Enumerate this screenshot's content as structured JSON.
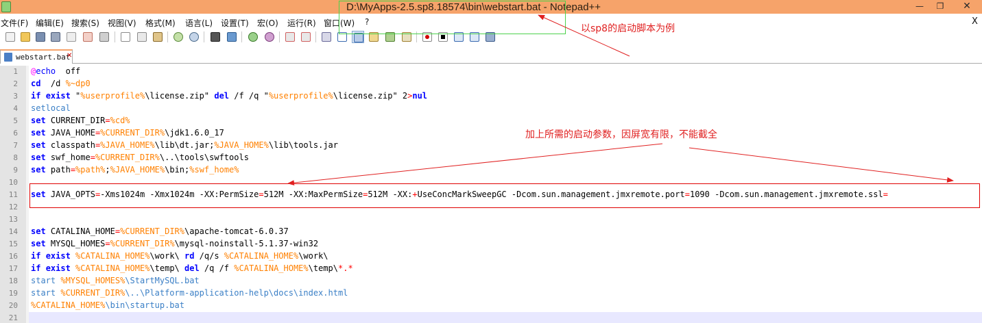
{
  "window": {
    "title": "D:\\MyApps-2.5.sp8.18574\\bin\\webstart.bat - Notepad++",
    "minimize_icon": "minimize-icon",
    "maximize_icon": "restore-icon",
    "close_icon": "close-icon",
    "minimize_glyph": "—",
    "maximize_glyph": "❐",
    "close_glyph": "✕",
    "title_bar_color": "#f6a36a"
  },
  "menu": {
    "items": [
      "文件(F)",
      "编辑(E)",
      "搜索(S)",
      "视图(V)",
      "格式(M)",
      "语言(L)",
      "设置(T)",
      "宏(O)",
      "运行(R)",
      "窗口(W)",
      "?"
    ],
    "close_glyph": "X"
  },
  "toolbar": {
    "icons": [
      "new-file-icon",
      "open-file-icon",
      "save-icon",
      "save-all-icon",
      "close-icon",
      "close-all-icon",
      "print-icon",
      "cut-icon",
      "copy-icon",
      "paste-icon",
      "undo-icon",
      "redo-icon",
      "find-icon",
      "replace-icon",
      "zoom-in-icon",
      "zoom-out-icon",
      "sync-vertical-icon",
      "sync-horizontal-icon",
      "word-wrap-icon",
      "show-all-chars-icon",
      "indent-guide-icon",
      "folder-workspace-icon",
      "doc-map-icon",
      "function-list-icon",
      "monitor-icon",
      "record-macro-icon",
      "stop-macro-icon",
      "play-macro-icon",
      "run-macro-multiple-icon",
      "save-macro-icon"
    ]
  },
  "tab": {
    "label": "webstart.bat",
    "close_glyph": "✕"
  },
  "editor": {
    "line_numbers": [
      "1",
      "2",
      "3",
      "4",
      "5",
      "6",
      "7",
      "8",
      "9",
      "10",
      "11",
      "12",
      "13",
      "14",
      "15",
      "16",
      "17",
      "18",
      "19",
      "20",
      "21"
    ],
    "lines": [
      [
        [
          "at",
          "@"
        ],
        [
          "kw2",
          "echo"
        ],
        [
          "",
          "  off"
        ]
      ],
      [
        [
          "kw",
          "cd"
        ],
        [
          "",
          "  /d "
        ],
        [
          "var",
          "%~dp0"
        ]
      ],
      [
        [
          "kw",
          "if"
        ],
        [
          "",
          " "
        ],
        [
          "kw",
          "exist"
        ],
        [
          "",
          " \""
        ],
        [
          "var",
          "%userprofile%"
        ],
        [
          "",
          "\\license.zip\" "
        ],
        [
          "kw",
          "del"
        ],
        [
          "",
          " /f /q \""
        ],
        [
          "var",
          "%userprofile%"
        ],
        [
          "",
          "\\license.zip\" 2"
        ],
        [
          "op",
          ">"
        ],
        [
          "kw",
          "nul"
        ]
      ],
      [
        [
          "cmd",
          "setlocal"
        ]
      ],
      [
        [
          "kw",
          "set"
        ],
        [
          "",
          " CURRENT_DIR"
        ],
        [
          "op",
          "="
        ],
        [
          "var",
          "%cd%"
        ]
      ],
      [
        [
          "kw",
          "set"
        ],
        [
          "",
          " JAVA_HOME"
        ],
        [
          "op",
          "="
        ],
        [
          "var",
          "%CURRENT_DIR%"
        ],
        [
          "",
          "\\jdk1.6.0_17"
        ]
      ],
      [
        [
          "kw",
          "set"
        ],
        [
          "",
          " classpath"
        ],
        [
          "op",
          "="
        ],
        [
          "var",
          "%JAVA_HOME%"
        ],
        [
          "",
          "\\lib\\dt.jar;"
        ],
        [
          "var",
          "%JAVA_HOME%"
        ],
        [
          "",
          "\\lib\\tools.jar"
        ]
      ],
      [
        [
          "kw",
          "set"
        ],
        [
          "",
          " swf_home"
        ],
        [
          "op",
          "="
        ],
        [
          "var",
          "%CURRENT_DIR%"
        ],
        [
          "",
          "\\..\\tools\\swftools"
        ]
      ],
      [
        [
          "kw",
          "set"
        ],
        [
          "",
          " path"
        ],
        [
          "op",
          "="
        ],
        [
          "var",
          "%path%"
        ],
        [
          "",
          ";"
        ],
        [
          "var",
          "%JAVA_HOME%"
        ],
        [
          "",
          "\\bin;"
        ],
        [
          "var",
          "%swf_home%"
        ]
      ],
      [],
      [
        [
          "kw",
          "set"
        ],
        [
          "",
          " JAVA_OPTS"
        ],
        [
          "op",
          "="
        ],
        [
          "",
          "-Xms1024m -Xmx1024m -XX:PermSize"
        ],
        [
          "op",
          "="
        ],
        [
          "",
          "512M -XX:MaxPermSize"
        ],
        [
          "op",
          "="
        ],
        [
          "",
          "512M -XX:"
        ],
        [
          "op",
          "+"
        ],
        [
          "",
          "UseConcMarkSweepGC -Dcom.sun.management.jmxremote.port"
        ],
        [
          "op",
          "="
        ],
        [
          "",
          "1090 -Dcom.sun.management.jmxremote.ssl"
        ],
        [
          "op",
          "="
        ]
      ],
      [],
      [],
      [
        [
          "kw",
          "set"
        ],
        [
          "",
          " CATALINA_HOME"
        ],
        [
          "op",
          "="
        ],
        [
          "var",
          "%CURRENT_DIR%"
        ],
        [
          "",
          "\\apache-tomcat-6.0.37"
        ]
      ],
      [
        [
          "kw",
          "set"
        ],
        [
          "",
          " MYSQL_HOMES"
        ],
        [
          "op",
          "="
        ],
        [
          "var",
          "%CURRENT_DIR%"
        ],
        [
          "",
          "\\mysql-noinstall-5.1.37-win32"
        ]
      ],
      [
        [
          "kw",
          "if"
        ],
        [
          "",
          " "
        ],
        [
          "kw",
          "exist"
        ],
        [
          "",
          " "
        ],
        [
          "var",
          "%CATALINA_HOME%"
        ],
        [
          "",
          "\\work\\ "
        ],
        [
          "kw",
          "rd"
        ],
        [
          "",
          " /q/s "
        ],
        [
          "var",
          "%CATALINA_HOME%"
        ],
        [
          "",
          "\\work\\"
        ]
      ],
      [
        [
          "kw",
          "if"
        ],
        [
          "",
          " "
        ],
        [
          "kw",
          "exist"
        ],
        [
          "",
          " "
        ],
        [
          "var",
          "%CATALINA_HOME%"
        ],
        [
          "",
          "\\temp\\ "
        ],
        [
          "kw",
          "del"
        ],
        [
          "",
          " /q /f "
        ],
        [
          "var",
          "%CATALINA_HOME%"
        ],
        [
          "",
          "\\temp\\"
        ],
        [
          "op",
          "*.*"
        ]
      ],
      [
        [
          "cmd",
          "start "
        ],
        [
          "var",
          "%MYSQL_HOMES%"
        ],
        [
          "cmd",
          "\\StartMySQL.bat"
        ]
      ],
      [
        [
          "cmd",
          "start "
        ],
        [
          "var",
          "%CURRENT_DIR%"
        ],
        [
          "cmd",
          "\\..\\Platform-application-help\\docs\\index.html"
        ]
      ],
      [
        [
          "var",
          "%CATALINA_HOME%"
        ],
        [
          "cmd",
          "\\bin\\startup.bat"
        ]
      ],
      []
    ]
  },
  "annotations": {
    "note_title": "以sp8的启动脚本为例",
    "note_params": "加上所需的启动参数，因屏宽有限，不能截全",
    "color": "#e02020"
  }
}
